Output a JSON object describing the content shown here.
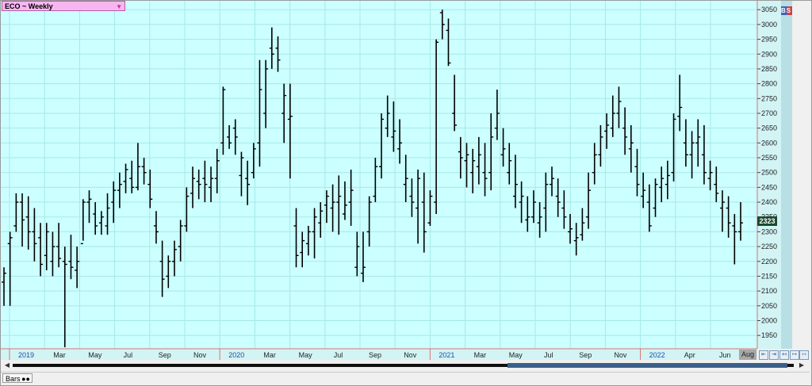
{
  "window": {
    "symbol_label": "ECO ~ Weekly",
    "dropdown_glyph": "▼",
    "bs_label": "BS",
    "last_price": "2323",
    "corner_month": "Aug",
    "bottom_tab": "Bars",
    "bottom_tab_icon": "binoculars-icon",
    "nav_buttons": [
      "⇤",
      "⇥",
      "↤",
      "↦",
      "⇿",
      "⇔"
    ]
  },
  "colors": {
    "plot_bg": "#ccffff",
    "grid": "#a6e8e8",
    "bar": "#000000",
    "year_label": "#1f4ea8",
    "right_axis_bg": "#d2f4f4",
    "right_strip": "#b8dfe4",
    "axis_red": "#e07070"
  },
  "chart_data": {
    "type": "bar",
    "bar_style": "OHLC",
    "title": "ECO ~ Weekly",
    "x_axis": {
      "labels": [
        {
          "text": "2019",
          "year": true
        },
        {
          "text": "Mar"
        },
        {
          "text": "May"
        },
        {
          "text": "Jul"
        },
        {
          "text": "Sep"
        },
        {
          "text": "Nov"
        },
        {
          "text": "2020",
          "year": true
        },
        {
          "text": "Mar"
        },
        {
          "text": "May"
        },
        {
          "text": "Jul"
        },
        {
          "text": "Sep"
        },
        {
          "text": "Nov"
        },
        {
          "text": "2021",
          "year": true
        },
        {
          "text": "Mar"
        },
        {
          "text": "May"
        },
        {
          "text": "Jul"
        },
        {
          "text": "Sep"
        },
        {
          "text": "Nov"
        },
        {
          "text": "2022",
          "year": true
        },
        {
          "text": "Apr"
        },
        {
          "text": "Jun"
        }
      ]
    },
    "y_axis": {
      "ylim": [
        1905,
        3080
      ],
      "ticks": [
        1950,
        2000,
        2050,
        2100,
        2150,
        2200,
        2250,
        2300,
        2350,
        2400,
        2450,
        2500,
        2550,
        2600,
        2650,
        2700,
        2750,
        2800,
        2850,
        2900,
        2950,
        3000,
        3050
      ],
      "position": "right"
    },
    "grid": true,
    "ohlc": [
      [
        2130,
        2180,
        2050,
        2160
      ],
      [
        2260,
        2300,
        2050,
        2280
      ],
      [
        2320,
        2430,
        2300,
        2400
      ],
      [
        2400,
        2430,
        2250,
        2340
      ],
      [
        2350,
        2420,
        2240,
        2300
      ],
      [
        2300,
        2380,
        2200,
        2260
      ],
      [
        2280,
        2330,
        2150,
        2190
      ],
      [
        2220,
        2330,
        2170,
        2300
      ],
      [
        2200,
        2300,
        2150,
        2250
      ],
      [
        2250,
        2330,
        2180,
        2210
      ],
      [
        2200,
        2250,
        1910,
        2190
      ],
      [
        2200,
        2290,
        2140,
        2180
      ],
      [
        2170,
        2250,
        2110,
        2200
      ],
      [
        2260,
        2410,
        2270,
        2400
      ],
      [
        2400,
        2440,
        2330,
        2410
      ],
      [
        2360,
        2400,
        2290,
        2320
      ],
      [
        2330,
        2370,
        2290,
        2350
      ],
      [
        2320,
        2430,
        2290,
        2380
      ],
      [
        2400,
        2470,
        2330,
        2440
      ],
      [
        2440,
        2500,
        2380,
        2460
      ],
      [
        2470,
        2530,
        2430,
        2510
      ],
      [
        2480,
        2540,
        2430,
        2450
      ],
      [
        2450,
        2600,
        2440,
        2520
      ],
      [
        2520,
        2550,
        2460,
        2500
      ],
      [
        2460,
        2510,
        2380,
        2410
      ],
      [
        2320,
        2370,
        2260,
        2300
      ],
      [
        2200,
        2270,
        2080,
        2140
      ],
      [
        2150,
        2220,
        2110,
        2200
      ],
      [
        2200,
        2270,
        2150,
        2240
      ],
      [
        2250,
        2340,
        2200,
        2320
      ],
      [
        2320,
        2450,
        2300,
        2420
      ],
      [
        2430,
        2520,
        2380,
        2480
      ],
      [
        2470,
        2510,
        2410,
        2460
      ],
      [
        2480,
        2540,
        2400,
        2460
      ],
      [
        2450,
        2520,
        2400,
        2480
      ],
      [
        2480,
        2580,
        2430,
        2540
      ],
      [
        2600,
        2790,
        2560,
        2780
      ],
      [
        2620,
        2660,
        2580,
        2600
      ],
      [
        2650,
        2680,
        2560,
        2620
      ],
      [
        2490,
        2570,
        2420,
        2550
      ],
      [
        2480,
        2540,
        2390,
        2460
      ],
      [
        2500,
        2600,
        2480,
        2580
      ],
      [
        2600,
        2880,
        2520,
        2780
      ],
      [
        2700,
        2880,
        2650,
        2850
      ],
      [
        2920,
        2990,
        2850,
        2900
      ],
      [
        2920,
        2960,
        2840,
        2880
      ],
      [
        2700,
        2800,
        2600,
        2760
      ],
      [
        2680,
        2800,
        2480,
        2690
      ],
      [
        2320,
        2380,
        2180,
        2220
      ],
      [
        2230,
        2300,
        2180,
        2270
      ],
      [
        2260,
        2320,
        2220,
        2300
      ],
      [
        2300,
        2380,
        2210,
        2350
      ],
      [
        2330,
        2400,
        2280,
        2370
      ],
      [
        2390,
        2440,
        2330,
        2420
      ],
      [
        2380,
        2460,
        2300,
        2400
      ],
      [
        2400,
        2490,
        2290,
        2420
      ],
      [
        2360,
        2470,
        2340,
        2390
      ],
      [
        2400,
        2510,
        2320,
        2440
      ],
      [
        2180,
        2300,
        2150,
        2250
      ],
      [
        2160,
        2300,
        2130,
        2180
      ],
      [
        2300,
        2420,
        2250,
        2400
      ],
      [
        2420,
        2550,
        2400,
        2520
      ],
      [
        2520,
        2700,
        2480,
        2680
      ],
      [
        2650,
        2760,
        2620,
        2700
      ],
      [
        2620,
        2740,
        2570,
        2640
      ],
      [
        2580,
        2680,
        2530,
        2600
      ],
      [
        2460,
        2560,
        2400,
        2480
      ],
      [
        2420,
        2480,
        2350,
        2400
      ],
      [
        2380,
        2510,
        2260,
        2480
      ],
      [
        2400,
        2500,
        2230,
        2300
      ],
      [
        2330,
        2440,
        2320,
        2420
      ],
      [
        2400,
        2950,
        2360,
        2940
      ],
      [
        3040,
        3050,
        2950,
        3000
      ],
      [
        2980,
        3020,
        2860,
        2870
      ],
      [
        2700,
        2830,
        2640,
        2660
      ],
      [
        2570,
        2620,
        2480,
        2550
      ],
      [
        2540,
        2600,
        2450,
        2560
      ],
      [
        2500,
        2580,
        2430,
        2540
      ],
      [
        2520,
        2620,
        2460,
        2560
      ],
      [
        2500,
        2600,
        2420,
        2480
      ],
      [
        2500,
        2700,
        2440,
        2620
      ],
      [
        2650,
        2780,
        2610,
        2700
      ],
      [
        2560,
        2650,
        2520,
        2580
      ],
      [
        2500,
        2600,
        2460,
        2540
      ],
      [
        2420,
        2560,
        2380,
        2460
      ],
      [
        2400,
        2470,
        2330,
        2420
      ],
      [
        2340,
        2420,
        2300,
        2350
      ],
      [
        2350,
        2440,
        2330,
        2400
      ],
      [
        2330,
        2400,
        2280,
        2350
      ],
      [
        2380,
        2500,
        2300,
        2460
      ],
      [
        2460,
        2520,
        2420,
        2480
      ],
      [
        2420,
        2480,
        2350,
        2400
      ],
      [
        2380,
        2440,
        2310,
        2350
      ],
      [
        2300,
        2360,
        2260,
        2310
      ],
      [
        2270,
        2330,
        2220,
        2280
      ],
      [
        2290,
        2380,
        2270,
        2330
      ],
      [
        2350,
        2500,
        2310,
        2440
      ],
      [
        2500,
        2600,
        2460,
        2560
      ],
      [
        2560,
        2660,
        2520,
        2620
      ],
      [
        2640,
        2700,
        2580,
        2660
      ],
      [
        2650,
        2760,
        2620,
        2700
      ],
      [
        2700,
        2790,
        2650,
        2740
      ],
      [
        2650,
        2720,
        2560,
        2620
      ],
      [
        2580,
        2660,
        2500,
        2600
      ],
      [
        2520,
        2580,
        2420,
        2460
      ],
      [
        2420,
        2500,
        2380,
        2440
      ],
      [
        2400,
        2460,
        2300,
        2320
      ],
      [
        2380,
        2480,
        2350,
        2460
      ],
      [
        2450,
        2520,
        2400,
        2480
      ],
      [
        2460,
        2540,
        2410,
        2490
      ],
      [
        2500,
        2700,
        2470,
        2680
      ],
      [
        2690,
        2830,
        2640,
        2720
      ],
      [
        2600,
        2680,
        2520,
        2560
      ],
      [
        2560,
        2640,
        2480,
        2600
      ],
      [
        2600,
        2680,
        2520,
        2620
      ],
      [
        2560,
        2660,
        2460,
        2500
      ],
      [
        2480,
        2540,
        2440,
        2500
      ],
      [
        2460,
        2520,
        2400,
        2430
      ],
      [
        2380,
        2440,
        2300,
        2400
      ],
      [
        2380,
        2420,
        2280,
        2330
      ],
      [
        2320,
        2360,
        2190,
        2300
      ],
      [
        2300,
        2400,
        2270,
        2330
      ]
    ]
  }
}
